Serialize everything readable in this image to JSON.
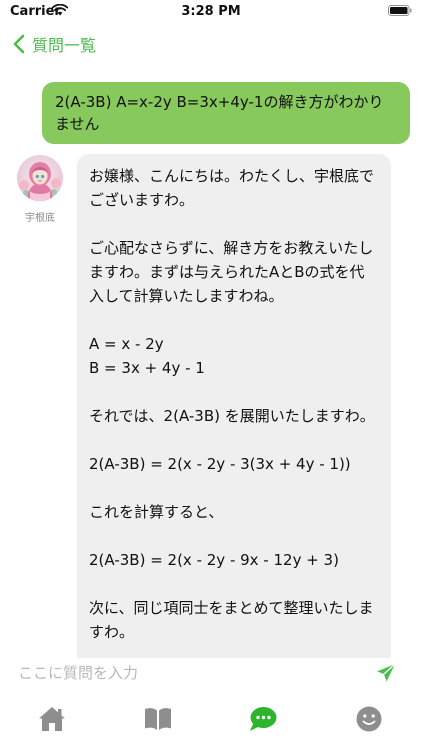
{
  "status_bar": {
    "carrier": "Carrier",
    "time": "3:28 PM"
  },
  "nav": {
    "back_label": "質問一覧"
  },
  "chat": {
    "user_message": "2(A-3B) A=x-2y B=3x+4y-1の解き方がわかりません",
    "bot_name": "宇根底",
    "bot_message": "お嬢様、こんにちは。わたくし、宇根底でございますわ。\n\nご心配なさらずに、解き方をお教えいたしますわ。まずは与えられたAとBの式を代入して計算いたしますわね。\n\nA = x - 2y\nB = 3x + 4y - 1\n\nそれでは、2(A-3B) を展開いたしますわ。\n\n2(A-3B) = 2(x - 2y - 3(3x + 4y - 1))\n\nこれを計算すると、\n\n2(A-3B) = 2(x - 2y - 9x - 12y + 3)\n\n次に、同じ項同士をまとめて整理いたしますわ。"
  },
  "input": {
    "placeholder": "ここに質問を入力",
    "value": ""
  },
  "tabs": [
    {
      "icon": "home-icon",
      "active": false
    },
    {
      "icon": "book-icon",
      "active": false
    },
    {
      "icon": "chat-bubble-icon",
      "active": true
    },
    {
      "icon": "smiley-icon",
      "active": false
    }
  ],
  "colors": {
    "accent": "#4cbb4c",
    "user_bubble": "#87c95c",
    "bot_bubble": "#efefef",
    "tab_inactive": "#8e8e8e",
    "tab_active": "#2db42d"
  }
}
